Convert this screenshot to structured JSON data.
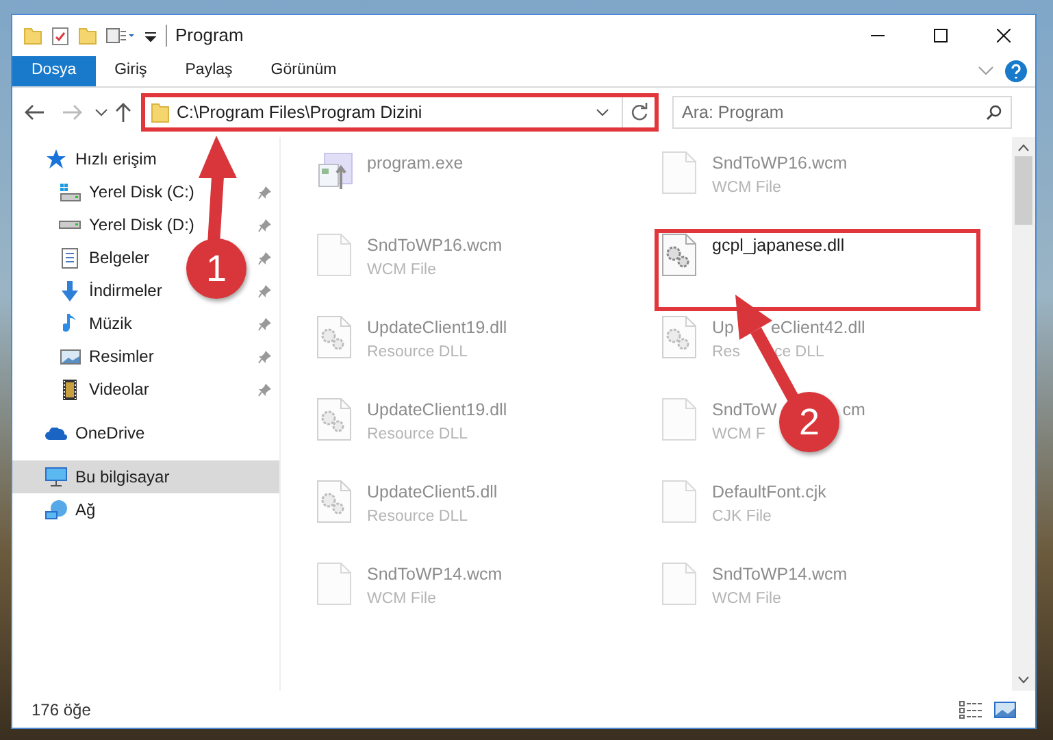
{
  "window": {
    "title": "Program"
  },
  "ribbon_tabs": [
    {
      "label": "Dosya",
      "selected": true
    },
    {
      "label": "Giriş",
      "selected": false
    },
    {
      "label": "Paylaş",
      "selected": false
    },
    {
      "label": "Görünüm",
      "selected": false
    }
  ],
  "address": {
    "path": "C:\\Program Files\\Program Dizini",
    "highlighted": true
  },
  "search": {
    "placeholder": "Ara: Program"
  },
  "navigation": [
    {
      "label": "Hızlı erişim",
      "kind": "star",
      "selected": false,
      "children": [
        {
          "label": "Yerel Disk (C:)",
          "kind": "systemdrive",
          "pinned": true,
          "selected": false
        },
        {
          "label": "Yerel Disk (D:)",
          "kind": "drive",
          "pinned": true,
          "selected": false
        },
        {
          "label": "Belgeler",
          "kind": "documents",
          "pinned": true,
          "selected": false
        },
        {
          "label": "İndirmeler",
          "kind": "downloads",
          "pinned": true,
          "selected": false
        },
        {
          "label": "Müzik",
          "kind": "music",
          "pinned": true,
          "selected": false
        },
        {
          "label": "Resimler",
          "kind": "pictures",
          "pinned": true,
          "selected": false
        },
        {
          "label": "Videolar",
          "kind": "videos",
          "pinned": true,
          "selected": false
        }
      ]
    },
    {
      "label": "OneDrive",
      "kind": "cloud",
      "selected": false
    },
    {
      "label": "Bu bilgisayar",
      "kind": "computer",
      "selected": true
    },
    {
      "label": "Ağ",
      "kind": "network",
      "selected": false
    }
  ],
  "files": [
    {
      "name": [
        "program.exe"
      ],
      "kind": "exe",
      "blurred": true,
      "highlighted": false
    },
    {
      "name": [
        "SndToWP16.wcm"
      ],
      "type": [
        "WCM File"
      ],
      "kind": "page",
      "blurred": true,
      "highlighted": false
    },
    {
      "name": [
        "SndToWP16.wcm"
      ],
      "type": [
        "WCM File"
      ],
      "kind": "page",
      "blurred": true,
      "highlighted": false
    },
    {
      "name": [
        "gcpl_japanese.dll"
      ],
      "kind": "dll",
      "blurred": false,
      "highlighted": true
    },
    {
      "name": [
        "UpdateClient19.dll"
      ],
      "type": [
        "Resource DLL"
      ],
      "kind": "dll",
      "blurred": true,
      "highlighted": false
    },
    {
      "name": [
        "Up",
        "eClient42.dll"
      ],
      "type": [
        "Res",
        "ce DLL"
      ],
      "kind": "dll",
      "blurred": true,
      "highlighted": false
    },
    {
      "name": [
        "UpdateClient19.dll"
      ],
      "type": [
        "Resource DLL"
      ],
      "kind": "dll",
      "blurred": true,
      "highlighted": false
    },
    {
      "name": [
        "SndToW",
        "cm"
      ],
      "type": [
        "WCM F"
      ],
      "kind": "page",
      "blurred": true,
      "highlighted": false
    },
    {
      "name": [
        "UpdateClient5.dll"
      ],
      "type": [
        "Resource DLL"
      ],
      "kind": "dll",
      "blurred": true,
      "highlighted": false
    },
    {
      "name": [
        "DefaultFont.cjk"
      ],
      "type": [
        "CJK File"
      ],
      "kind": "page",
      "blurred": true,
      "highlighted": false
    },
    {
      "name": [
        "SndToWP14.wcm"
      ],
      "type": [
        "WCM File"
      ],
      "kind": "page",
      "blurred": true,
      "highlighted": false
    },
    {
      "name": [
        "SndToWP14.wcm"
      ],
      "type": [
        "WCM File"
      ],
      "kind": "page",
      "blurred": true,
      "highlighted": false
    }
  ],
  "status_bar": {
    "item_count": "176 öğe"
  },
  "annotations": [
    {
      "number": "1"
    },
    {
      "number": "2"
    }
  ]
}
